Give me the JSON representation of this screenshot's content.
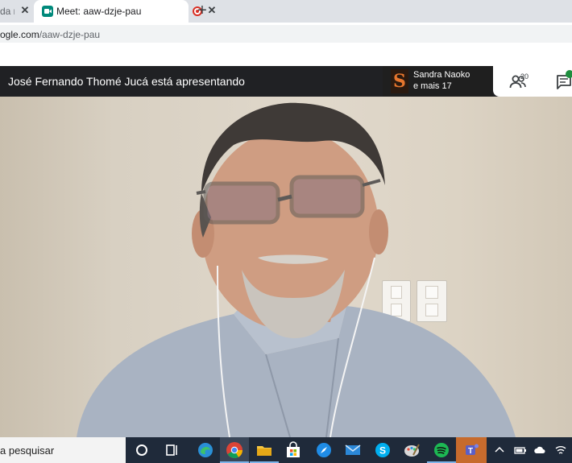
{
  "browser": {
    "tabs": [
      {
        "title": "da re",
        "active": false
      },
      {
        "title": "Meet: aaw-dzje-pau",
        "active": true,
        "recording": true
      }
    ],
    "new_tab_label": "+",
    "address": {
      "host": "ogle.com",
      "path": "/aaw-dzje-pau"
    }
  },
  "meet": {
    "presenting_text": "José Fernando Thomé Jucá está apresentando",
    "active_speaker": {
      "avatar_letter": "S",
      "name": "Sandra Naoko",
      "more": "e mais 17"
    },
    "participant_count": "20",
    "colors": {
      "header_bg": "#202124",
      "accent": "#1e8e3e",
      "record": "#d93025"
    }
  },
  "taskbar": {
    "search_placeholder": "a pesquisar",
    "apps": [
      "cortana-icon",
      "task-view-icon",
      "edge-icon",
      "chrome-icon",
      "file-explorer-icon",
      "store-icon",
      "safari-like-icon",
      "mail-icon",
      "skype-icon",
      "paint-icon",
      "spotify-icon",
      "teams-icon"
    ],
    "tray": [
      "chevron-up-icon",
      "battery-icon",
      "cloud-icon",
      "wifi-icon"
    ]
  }
}
